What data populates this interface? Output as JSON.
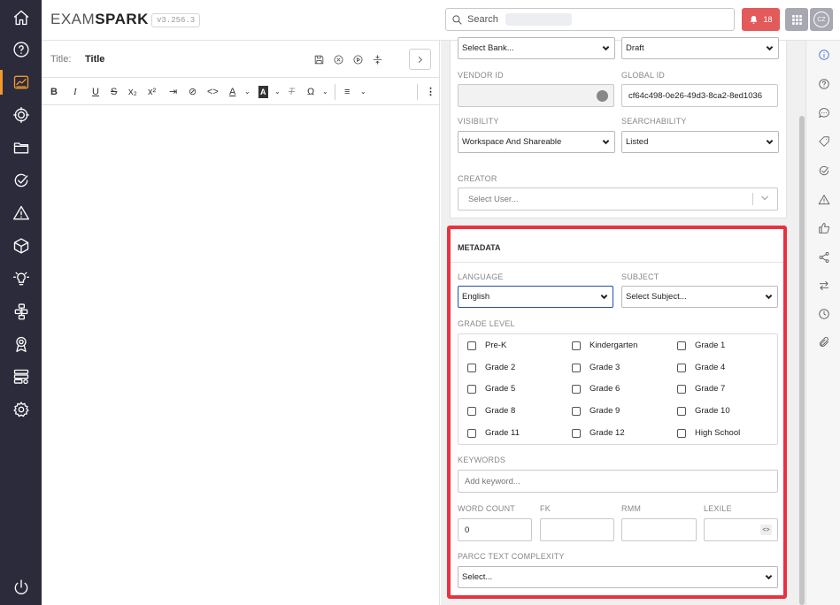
{
  "app": {
    "logo_exam": "EXAM",
    "logo_spark": "SPARK",
    "version": "v3.256.3",
    "search_placeholder": "Search",
    "notification_count": "18",
    "avatar_initials": "CZ"
  },
  "leftnav": {
    "icons": [
      "home-icon",
      "help-icon",
      "reports-icon",
      "target-icon",
      "folder-icon",
      "check-circle-icon",
      "warning-icon",
      "cube-icon",
      "lightbulb-icon",
      "hierarchy-icon",
      "badge-icon",
      "server-settings-icon",
      "gear-icon"
    ],
    "bottom_icon": "power-icon",
    "active": "reports-icon"
  },
  "editor": {
    "title_label": "Title:",
    "title_value": "Title",
    "title_icons": [
      "save-icon",
      "close-circle-icon",
      "play-icon",
      "expand-vertical-icon"
    ],
    "toolbar": {
      "bold": "B",
      "italic": "I",
      "underline": "U",
      "strike": "S",
      "subscript": "x₂",
      "superscript": "x²",
      "indent": "⇥",
      "link": "⊘",
      "code": "<>",
      "font_color": "A",
      "bg_color": "A",
      "clear": "T",
      "special_char": "Ω",
      "align": "≡",
      "more": "⋮"
    }
  },
  "details": {
    "bank_select": "Select Bank...",
    "status_select": "Draft",
    "vendor_id_label": "VENDOR ID",
    "vendor_id_value": "",
    "global_id_label": "GLOBAL ID",
    "global_id_value": "cf64c498-0e26-49d3-8ca2-8ed1036",
    "visibility_label": "VISIBILITY",
    "visibility_value": "Workspace And Shareable",
    "searchability_label": "SEARCHABILITY",
    "searchability_value": "Listed",
    "creator_label": "CREATOR",
    "creator_placeholder": "Select User..."
  },
  "metadata": {
    "heading": "METADATA",
    "language_label": "LANGUAGE",
    "language_value": "English",
    "subject_label": "SUBJECT",
    "subject_value": "Select Subject...",
    "grade_level_label": "GRADE LEVEL",
    "grades": [
      "Pre-K",
      "Kindergarten",
      "Grade 1",
      "Grade 2",
      "Grade 3",
      "Grade 4",
      "Grade 5",
      "Grade 6",
      "Grade 7",
      "Grade 8",
      "Grade 9",
      "Grade 10",
      "Grade 11",
      "Grade 12",
      "High School"
    ],
    "keywords_label": "KEYWORDS",
    "keywords_placeholder": "Add keyword...",
    "word_count_label": "WORD COUNT",
    "word_count_value": "0",
    "fk_label": "FK",
    "rmm_label": "RMM",
    "lexile_label": "LEXILE",
    "lexile_icon": "<>",
    "parcc_label": "PARCC TEXT COMPLEXITY",
    "parcc_value": "Select..."
  },
  "rail": {
    "icons": [
      "info-icon",
      "help-icon",
      "comment-icon",
      "tag-icon",
      "check-circle-icon",
      "warning-icon",
      "thumbs-up-icon",
      "share-icon",
      "swap-icon",
      "history-icon",
      "paperclip-icon"
    ],
    "active": "info-icon"
  }
}
